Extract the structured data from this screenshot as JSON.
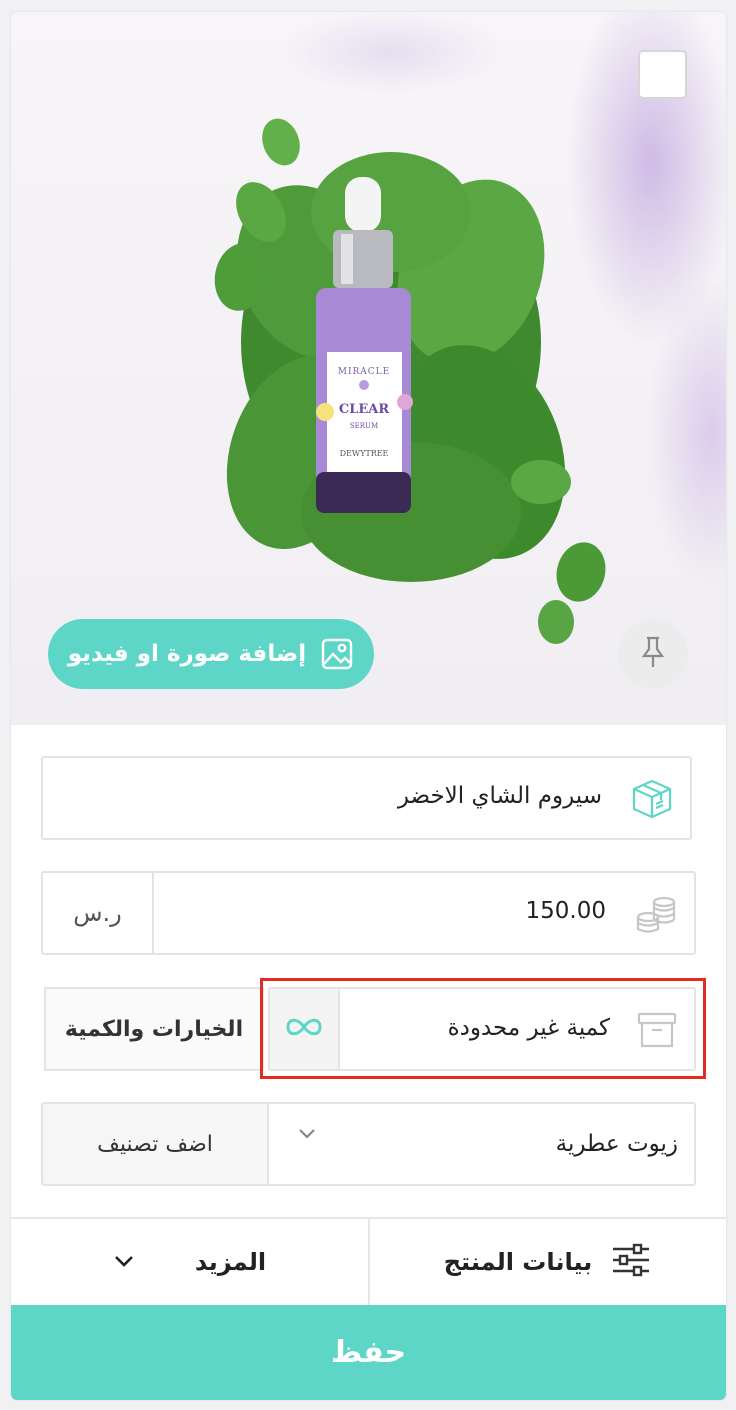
{
  "media": {
    "add_label": "إضافة صورة او فيديو",
    "product_label_brand": "MIRACLE",
    "product_label_name": "CLEAR",
    "product_label_type": "SERUM",
    "product_label_maker": "DEWYTREE"
  },
  "form": {
    "product_name": "سيروم الشاي الاخضر",
    "price": "150.00",
    "currency": "ر.س",
    "quantity_text": "كمية غير محدودة",
    "options_label": "الخيارات والكمية",
    "category_value": "زيوت عطرية",
    "add_category_label": "اضف تصنيف"
  },
  "tabs": {
    "product_data": "بيانات المنتج",
    "more": "المزيد"
  },
  "save_label": "حفظ",
  "colors": {
    "accent": "#5ed6c7",
    "highlight": "#e52a24"
  }
}
